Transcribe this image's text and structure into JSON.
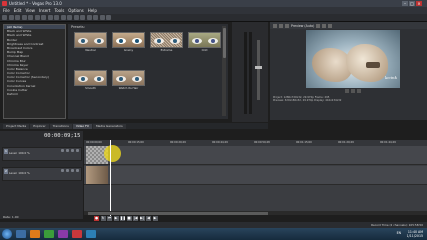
{
  "window": {
    "title": "Untitled * - Vegas Pro 13.0",
    "controls": [
      "minimize",
      "maximize",
      "close"
    ]
  },
  "menu": [
    "File",
    "Edit",
    "View",
    "Insert",
    "Tools",
    "Options",
    "Help"
  ],
  "fx_list": {
    "items": [
      "(All Items)",
      "Black and White",
      "Black and White",
      "Border",
      "Brightness and Contrast",
      "Broadcast Colors",
      "Bump Map",
      "Channel Blend",
      "Chroma Blur",
      "Chroma Keyer",
      "Color Balance",
      "Color Corrector",
      "Color Corrector (Secondary)",
      "Color Curves",
      "Convolution Kernel",
      "Cookie Cutter",
      "Deform"
    ],
    "selected_index": 0
  },
  "presets": {
    "header": "Presets:",
    "items": [
      "Neutral",
      "Grainy",
      "Extreme",
      "Odd",
      "Smooth",
      "Watch Its Hair"
    ]
  },
  "preview": {
    "toolbar_label": "Preview (Auto)",
    "watermark": "lecink",
    "info": [
      "Project: 1280x720x32, 29.970p    Frame: 295",
      "Preview: 320x180x32, 29.970p    Display: 416x234x32"
    ]
  },
  "tabs": [
    "Project Media",
    "Explorer",
    "Transitions",
    "Video FX",
    "Media Generators"
  ],
  "active_tab": 3,
  "timeline": {
    "timecode": "00:00:09;15",
    "tracks": [
      {
        "number": "1",
        "level": "Level: 100.0 %"
      },
      {
        "number": "2",
        "level": "Level: 100.0 %"
      }
    ],
    "ruler": [
      "00:00:00;00",
      "00:00:15;00",
      "00:00:29;29",
      "00:00:44;29",
      "00:00:59;28",
      "00:01:15;00",
      "00:01:29;29",
      "00:01:44;29"
    ],
    "rate": "Rate: 1.00"
  },
  "status": {
    "record_time": "Record Time (2 channels): 105:58:50"
  },
  "taskbar": {
    "lang": "EN",
    "time": "11:40 AM",
    "date": "1/11/2015"
  },
  "colors": {
    "accent_highlight": "#e6d21e",
    "panel_bg": "#2b2d31",
    "title_bar": "#3a3f48"
  }
}
